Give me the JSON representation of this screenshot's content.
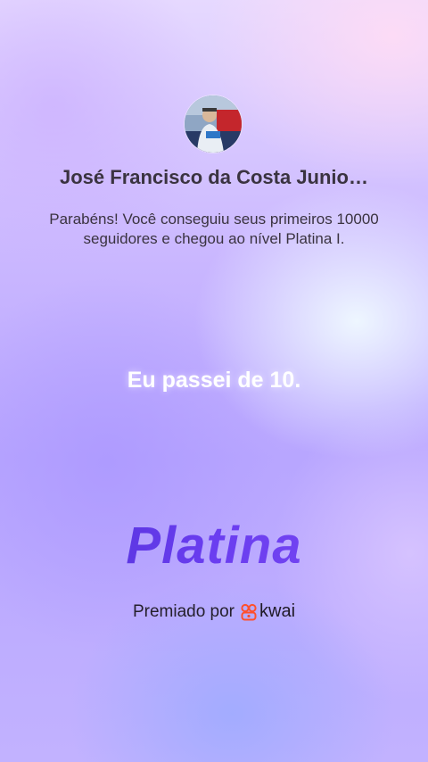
{
  "profile": {
    "name": "José Francisco da Costa Junio…"
  },
  "message": "Parabéns! Você conseguiu seus primeiros 10000 seguidores e chegou ao nível Platina I.",
  "headline": "Eu passei de 10.",
  "level": "Platina",
  "awarded": {
    "prefix": "Premiado por",
    "brand": "kwai",
    "brand_icon": "kwai-logo-icon",
    "brand_icon_color": "#ff4f2c"
  },
  "colors": {
    "level_text": "#5a3ed6",
    "text_dark": "#3a3340",
    "headline": "#ffffff"
  }
}
